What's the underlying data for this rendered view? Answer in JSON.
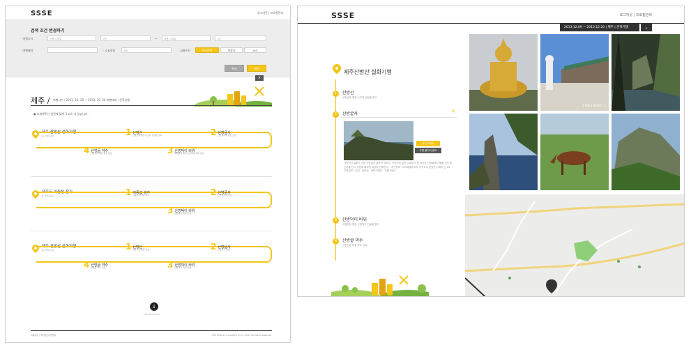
{
  "left": {
    "logo": "SSSE",
    "toplinks": "로그아웃 | 프로필관리",
    "search": {
      "title": "검색 조건 변경하기",
      "row1_label": "· 여행시기",
      "date1_placeholder": "여행 시작일",
      "time1_placeholder": "시간",
      "tilde": "~",
      "date2_placeholder": "여행 시작일",
      "time2_placeholder": "시간",
      "row2_label": "· 여행테마",
      "row2_label2": "· 소요경비",
      "budget_placeholder": "경비",
      "row2_label3": "· 교통수단",
      "transport_options": [
        "자가운전",
        "자동차",
        "버스"
      ],
      "reset_label": "취소",
      "confirm_label": "확인"
    },
    "close_label": "×",
    "region": "제주 /",
    "region_meta": "여행시기 / 2013. 10. 29 ~ 2013. 10. 30   여행테마 : 문학기행",
    "note": "● 조회해주신 일정에 맞게 3 코스 가 있습니다.",
    "courses": [
      {
        "title": "제주 산방산 설화기행",
        "sub": "총 4개의 장소",
        "stops": [
          {
            "num": "1",
            "name": "산방산",
            "sub": "산방산에 얽힌 나르마 전설을 보자"
          },
          {
            "num": "2",
            "name": "산방굴사",
            "sub": "산방굴사에 얽힌 전설"
          },
          {
            "num": "3",
            "name": "산방덕이 바위",
            "sub": "대정현에 얽힌 산방덕이 바위 전설"
          },
          {
            "num": "4",
            "name": "산방굴 약수",
            "sub": "산방산에 얽힌 약수 전설"
          }
        ]
      },
      {
        "title": "제주도 이중섭 전기",
        "sub": "총 3개의 장소",
        "stops": [
          {
            "num": "1",
            "name": "이중섭 생가",
            "sub": "이중섭 생가를 찾다"
          },
          {
            "num": "2",
            "name": "산방굴사",
            "sub": "산방굴사의 전설"
          },
          {
            "num": "3",
            "name": "산방덕이 바위",
            "sub": "산방덕이 바위 전설"
          }
        ]
      },
      {
        "title": "제주 산방산 설화기행",
        "sub": "총 4개의 장소",
        "stops": [
          {
            "num": "1",
            "name": "산방산",
            "sub": "산방산에 얽힌 전설"
          },
          {
            "num": "2",
            "name": "산방굴사",
            "sub": "산방굴사 전설"
          },
          {
            "num": "3",
            "name": "산방덕이 바위",
            "sub": "산방덕이 바위 전설"
          },
          {
            "num": "4",
            "name": "산방굴 약수",
            "sub": "산방굴 약수 전설"
          }
        ]
      }
    ],
    "more_label": "Load More Tour",
    "footer_left": "이용약관 | 개인정보취급방침",
    "footer_right": "THETOWN 21 Consulting Inc.(c) 2013 All Rights Reserved."
  },
  "right": {
    "logo": "SSSE",
    "toplinks": "로그아웃 | 프로필관리",
    "datebar": "2013.12.09 ~ 2013.12.20  |  제주  |  문학기행",
    "datebar_arrow": "⌄",
    "course_title": "제주산방산 설화기행",
    "stops": [
      {
        "num": "1",
        "name": "산방산",
        "desc": "산방산에 얽힌 나르마 전설을 찾다"
      },
      {
        "num": "2",
        "name": "산방굴사",
        "desc": ""
      },
      {
        "num": "3",
        "name": "산방덕이 바위",
        "desc": "대정현에 얽힌 산방덕이 전설을 찾다"
      },
      {
        "num": "4",
        "name": "산방굴 약수",
        "desc": "산방산에 얽힌 약수 전설"
      }
    ],
    "btn_photo": "사진 더보기",
    "btn_map": "주변 볼거리 정보",
    "detail_text": "산방덕이 설화가 전한 산방굴사 설화의 장소다. 산방산에 살던 나르마가 한 아이가 산방굴에서 물을 긷던 중 선녀를 만나 사랑에 빠지게 되었다 전해진다. · 개관정보 : 제주특별자치도 서귀포시 안덕면 사계리 산 16 · 주변정보 : 맛집 · 산방산 · 용머리해안 · 하멜기념비",
    "photo_label": "일본불교사진보기 >"
  }
}
